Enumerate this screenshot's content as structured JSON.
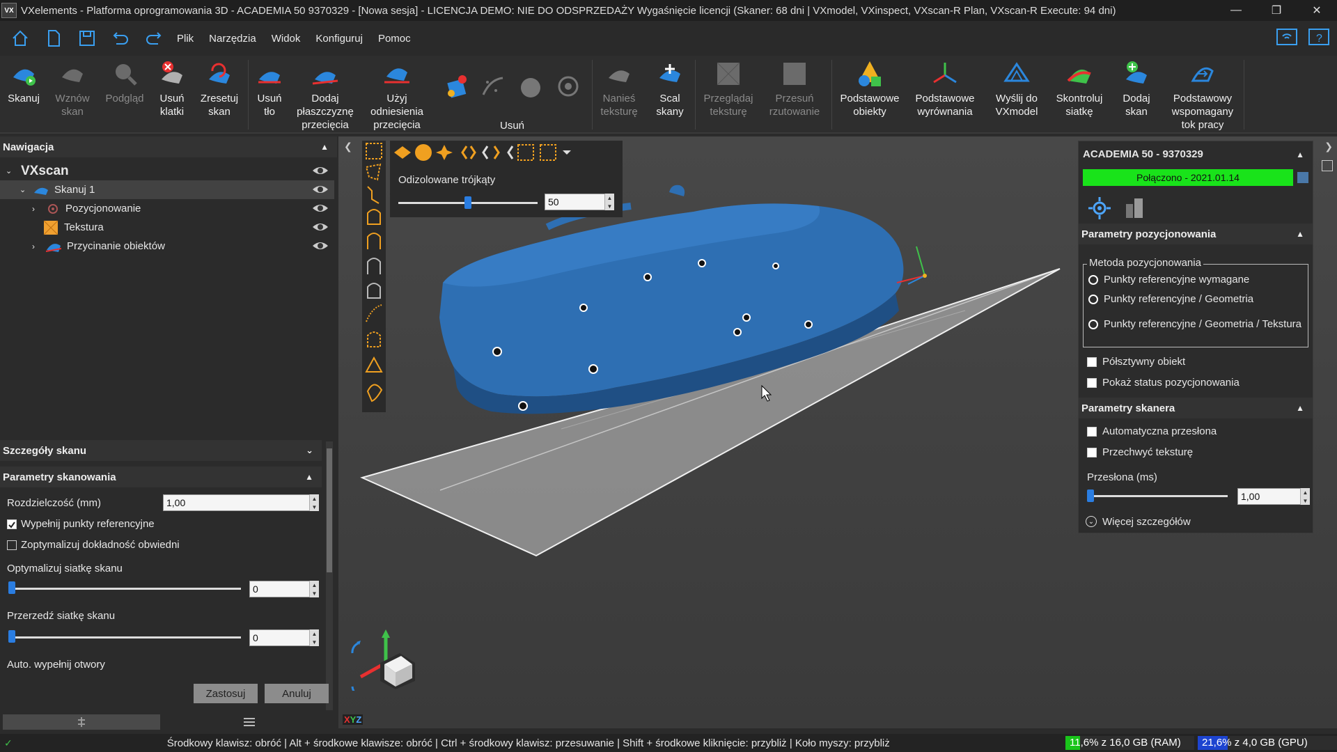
{
  "window": {
    "logo_text": "VX",
    "title": "VXelements - Platforma oprogramowania 3D - ACADEMIA 50 9370329 - [Nowa sesja] - LICENCJA DEMO: NIE DO ODSPRZEDAŻY Wygaśnięcie licencji (Skaner: 68 dni | VXmodel, VXinspect, VXscan-R Plan, VXscan-R Execute: 94 dni)"
  },
  "menu": [
    "Plik",
    "Narzędzia",
    "Widok",
    "Konfiguruj",
    "Pomoc"
  ],
  "ribbon": {
    "skanuj": "Skanuj",
    "wznow": [
      "Wznów",
      "skan"
    ],
    "podglad": "Podgląd",
    "usun_klatki": [
      "Usuń",
      "klatki"
    ],
    "zresetuj": [
      "Zresetuj",
      "skan"
    ],
    "usun_tlo": [
      "Usuń",
      "tło"
    ],
    "dodaj_plaszcz": [
      "Dodaj",
      "płaszczyznę",
      "przecięcia"
    ],
    "uzyj_odniesienia": [
      "Użyj",
      "odniesienia",
      "przecięcia"
    ],
    "usun_group": "Usuń",
    "nanies": [
      "Nanieś",
      "teksturę"
    ],
    "scal": [
      "Scal",
      "skany"
    ],
    "przegladaj": [
      "Przeglądaj",
      "teksturę"
    ],
    "przesun": [
      "Przesuń",
      "rzutowanie"
    ],
    "podst_obiekty": [
      "Podstawowe",
      "obiekty"
    ],
    "podst_wyrownania": [
      "Podstawowe",
      "wyrównania"
    ],
    "wyslij": [
      "Wyślij do",
      "VXmodel"
    ],
    "skontroluj": [
      "Skontroluj",
      "siatkę"
    ],
    "dodaj_skan": [
      "Dodaj",
      "skan"
    ],
    "podst_wspomagany": [
      "Podstawowy",
      "wspomagany",
      "tok pracy"
    ]
  },
  "navigation": {
    "header": "Nawigacja",
    "root": "VXscan",
    "items": [
      "Skanuj 1",
      "Pozycjonowanie",
      "Tekstura",
      "Przycinanie obiektów"
    ]
  },
  "details": {
    "header": "Szczegóły skanu",
    "params_header": "Parametry skanowania",
    "resolution_label": "Rozdzielczość (mm)",
    "resolution_value": "1,00",
    "fill_targets": "Wypełnij punkty referencyjne",
    "fill_targets_checked": true,
    "optimize_accuracy": "Zoptymalizuj dokładność obwiedni",
    "optimize_accuracy_checked": false,
    "optimize_mesh_label": "Optymalizuj siatkę skanu",
    "optimize_mesh_value": "0",
    "decimate_label": "Przerzedź siatkę skanu",
    "decimate_value": "0",
    "autofill_label": "Auto. wypełnij otwory",
    "apply": "Zastosuj",
    "cancel": "Anuluj"
  },
  "viewport": {
    "isolated_label": "Odizolowane trójkąty",
    "isolated_value": "50",
    "isolated_fraction": 0.5,
    "axes_label_x": "X",
    "axes_label_y": "Y",
    "axes_label_z": "Z"
  },
  "scanner_panel": {
    "title": "ACADEMIA 50 - 9370329",
    "status": "Połączono - 2021.01.14",
    "status_color": "#19e31a",
    "pos_params_header": "Parametry pozycjonowania",
    "method_label": "Metoda pozycjonowania",
    "methods": [
      "Punkty referencyjne wymagane",
      "Punkty referencyjne / Geometria",
      "Punkty referencyjne / Geometria / Tekstura"
    ],
    "selected_method": 1,
    "semi_rigid": "Półsztywny obiekt",
    "show_status": "Pokaż status pozycjonowania",
    "scanner_params_header": "Parametry skanera",
    "auto_shutter": "Automatyczna przesłona",
    "capture_texture": "Przechwyć teksturę",
    "shutter_label": "Przesłona (ms)",
    "shutter_value": "1,00",
    "more_details": "Więcej szczegółów"
  },
  "statusbar": {
    "hints": "Środkowy klawisz: obróć  |  Alt + środkowe klawisze: obróć  |  Ctrl + środkowy klawisz: przesuwanie  |  Shift + środkowe kliknięcie: przybliż  |  Koło myszy: przybliż",
    "ram": "11,6% z 16,0 GB (RAM)",
    "ram_fraction": 0.116,
    "gpu": "21,6% z 4,0 GB (GPU)",
    "gpu_fraction": 0.216
  }
}
